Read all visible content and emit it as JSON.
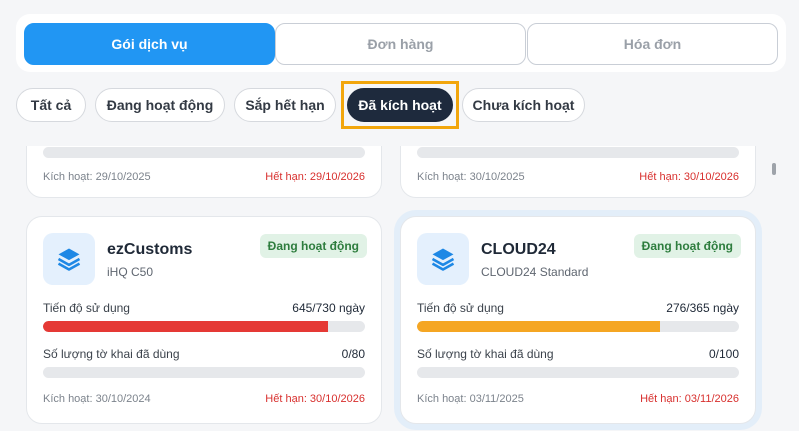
{
  "tabs": [
    "Gói dịch vụ",
    "Đơn hàng",
    "Hóa đơn"
  ],
  "filters": [
    "Tất cả",
    "Đang hoạt động",
    "Sắp hết hạn",
    "Đã kích hoạt",
    "Chưa kích hoạt"
  ],
  "colors": {
    "accent": "#2196f3",
    "dark": "#1e2a3d",
    "red_bar": "#e53935",
    "orange_bar": "#f5a623",
    "expiry": "#d8302e"
  },
  "top_cards": [
    {
      "activated": "Kích hoạt: 29/10/2025",
      "expiry": "Hết hạn: 29/10/2026"
    },
    {
      "activated": "Kích hoạt: 30/10/2025",
      "expiry": "Hết hạn: 30/10/2026"
    }
  ],
  "cards": [
    {
      "icon": "layers-icon",
      "name": "ezCustoms",
      "plan": "iHQ C50",
      "status": "Đang hoạt động",
      "usage_label": "Tiến độ sử dụng",
      "usage_value": "645/730 ngày",
      "usage_fraction": 0.884,
      "usage_color": "#e53935",
      "decl_label": "Số lượng tờ khai đã dùng",
      "decl_value": "0/80",
      "decl_fraction": 0,
      "activated": "Kích hoạt: 30/10/2024",
      "expiry": "Hết hạn: 30/10/2026"
    },
    {
      "icon": "layers-icon",
      "name": "CLOUD24",
      "plan": "CLOUD24 Standard",
      "status": "Đang hoạt động",
      "usage_label": "Tiến độ sử dụng",
      "usage_value": "276/365 ngày",
      "usage_fraction": 0.756,
      "usage_color": "#f5a623",
      "decl_label": "Số lượng tờ khai đã dùng",
      "decl_value": "0/100",
      "decl_fraction": 0,
      "activated": "Kích hoạt: 03/11/2025",
      "expiry": "Hết hạn: 03/11/2026"
    }
  ]
}
